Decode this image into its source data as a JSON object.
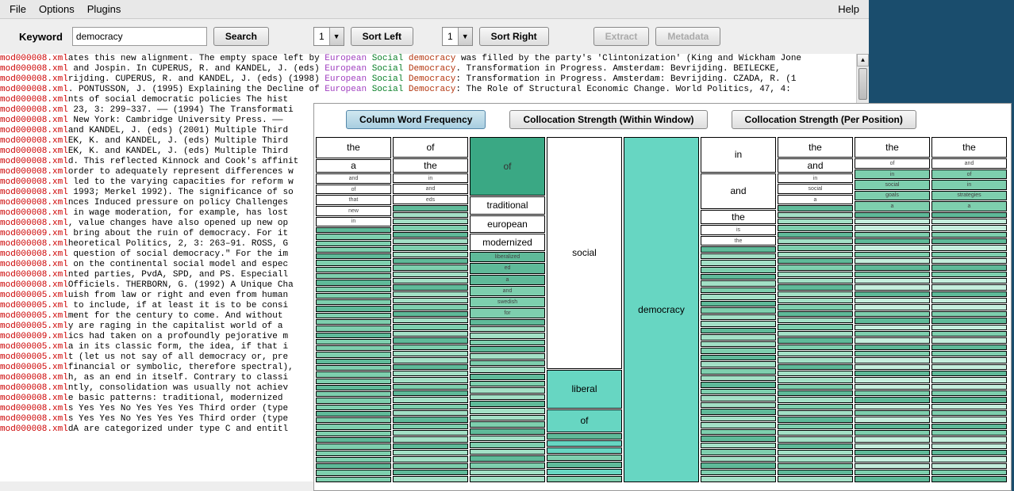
{
  "menubar": {
    "file": "File",
    "options": "Options",
    "plugins": "Plugins",
    "help": "Help"
  },
  "toolbar": {
    "keyword_label": "Keyword",
    "keyword_value": "democracy",
    "search": "Search",
    "sort_left": "Sort Left",
    "sort_right": "Sort Right",
    "extract": "Extract",
    "metadata": "Metadata",
    "sel_left": "1",
    "sel_right": "1"
  },
  "overlay": {
    "tab1": "Column Word Frequency",
    "tab2": "Collocation Strength (Within Window)",
    "tab3": "Collocation Strength (Per Position)"
  },
  "mosaic": {
    "col0": [
      "the",
      "a",
      "and",
      "of",
      "that",
      "new",
      "in"
    ],
    "col1": [
      "of",
      "the",
      "in",
      "and",
      "eds"
    ],
    "col2": [
      "of",
      "traditional",
      "european",
      "modernized",
      "liberalized",
      "ed",
      "a",
      "and",
      "swedish",
      "for"
    ],
    "col3": [
      "social",
      "liberal",
      "of"
    ],
    "col4": [
      "democracy"
    ],
    "col5": [
      "in",
      "and",
      "the",
      "is",
      "the"
    ],
    "col6": [
      "the",
      "and",
      "in",
      "social",
      "a"
    ],
    "col7": [
      "the",
      "of",
      "in",
      "social",
      "goals",
      "a"
    ],
    "col8": [
      "the",
      "and",
      "of",
      "in",
      "strategies",
      "a"
    ]
  },
  "concordance": [
    {
      "f": "mod000008.xml",
      "l": "ates this new alignment. The empty space left by ",
      "a": "European",
      "b": "Social",
      "c": "democracy",
      "r": " was filled by the party's 'Clintonization' (King and Wickham Jone"
    },
    {
      "f": "mod000008.xml",
      "l": " and Jospin. In CUPERUS, R. and KANDEL, J. (eds) ",
      "a": "European",
      "b": "Social",
      "c": "Democracy",
      "r": ". Transformation in Progress. Amsterdam: Bevrijding. BEILECKE,"
    },
    {
      "f": "mod000008.xml",
      "l": "rijding. CUPERUS, R. and KANDEL, J. (eds) (1998) ",
      "a": "European",
      "b": "Social",
      "c": "Democracy",
      "r": ": Transformation in Progress. Amsterdam: Bevrijding. CZADA, R. (1"
    },
    {
      "f": "mod000008.xml",
      "l": ". PONTUSSON, J. (1995) Explaining the Decline of ",
      "a": "European",
      "b": "Social",
      "c": "Democracy",
      "r": ": The Role of Structural Economic Change. World Politics, 47, 4:"
    },
    {
      "f": "mod000008.xml",
      "l": "nts of social democratic policies The hist",
      "a": "",
      "b": "",
      "c": "",
      "r": ""
    },
    {
      "f": "mod000008.xml",
      "l": " 23, 3: 299–337. —— (1994) The Transformati",
      "a": "",
      "b": "",
      "c": "",
      "r": ""
    },
    {
      "f": "mod000008.xml",
      "l": " New York: Cambridge University Press. ——",
      "a": "",
      "b": "",
      "c": "",
      "r": ""
    },
    {
      "f": "mod000008.xml",
      "l": "and KANDEL, J. (eds) (2001) Multiple Third",
      "a": "",
      "b": "",
      "c": "",
      "r": ""
    },
    {
      "f": "mod000008.xml",
      "l": "EK, K. and KANDEL, J. (eds) Multiple Third",
      "a": "",
      "b": "",
      "c": "",
      "r": ""
    },
    {
      "f": "mod000008.xml",
      "l": "EK, K. and KANDEL, J. (eds) Multiple Third",
      "a": "",
      "b": "",
      "c": "",
      "r": ""
    },
    {
      "f": "mod000008.xml",
      "l": "d. This reflected Kinnock and Cook's affinit",
      "a": "",
      "b": "",
      "c": "",
      "r": ""
    },
    {
      "f": "mod000008.xml",
      "l": "order to adequately represent differences w",
      "a": "",
      "b": "",
      "c": "",
      "r": ""
    },
    {
      "f": "mod000008.xml",
      "l": " led to the varying capacities for reform w",
      "a": "",
      "b": "",
      "c": "",
      "r": ""
    },
    {
      "f": "mod000008.xml",
      "l": " 1993; Merkel 1992). The significance of so",
      "a": "",
      "b": "",
      "c": "",
      "r": ""
    },
    {
      "f": "mod000008.xml",
      "l": "nces Induced pressure on policy Challenges",
      "a": "",
      "b": "",
      "c": "",
      "r": ""
    },
    {
      "f": "mod000008.xml",
      "l": " in wage moderation, for example, has lost",
      "a": "",
      "b": "",
      "c": "",
      "r": ""
    },
    {
      "f": "mod000008.xml",
      "l": ", value changes have also opened up new op",
      "a": "",
      "b": "",
      "c": "",
      "r": ""
    },
    {
      "f": "mod000009.xml",
      "l": " bring about the ruin of democracy. For it",
      "a": "",
      "b": "",
      "c": "",
      "r": ""
    },
    {
      "f": "mod000008.xml",
      "l": "heoretical Politics, 2, 3: 263–91. ROSS, G",
      "a": "",
      "b": "",
      "c": "",
      "r": ""
    },
    {
      "f": "mod000008.xml",
      "l": " question of social democracy.\" For the im",
      "a": "",
      "b": "",
      "c": "",
      "r": ""
    },
    {
      "f": "mod000008.xml",
      "l": " on the continental social model and espec",
      "a": "",
      "b": "",
      "c": "",
      "r": ""
    },
    {
      "f": "mod000008.xml",
      "l": "nted parties, PvdA, SPD, and PS. Especiall",
      "a": "",
      "b": "",
      "c": "",
      "r": ""
    },
    {
      "f": "mod000008.xml",
      "l": "Officiels. THERBORN, G. (1992) A Unique Cha",
      "a": "",
      "b": "",
      "c": "",
      "r": ""
    },
    {
      "f": "mod000005.xml",
      "l": "uish from law or right and even from human",
      "a": "",
      "b": "",
      "c": "",
      "r": ""
    },
    {
      "f": "mod000005.xml",
      "l": " to include, if at least it is to be consi",
      "a": "",
      "b": "",
      "c": "",
      "r": ""
    },
    {
      "f": "mod000005.xml",
      "l": "ment for the century to come. And without",
      "a": "",
      "b": "",
      "c": "",
      "r": ""
    },
    {
      "f": "mod000005.xml",
      "l": "y are raging in the capitalist world of a",
      "a": "",
      "b": "",
      "c": "",
      "r": ""
    },
    {
      "f": "mod000009.xml",
      "l": "ics had taken on a profoundly pejorative m",
      "a": "",
      "b": "",
      "c": "",
      "r": ""
    },
    {
      "f": "mod000005.xml",
      "l": "a in its classic form, the idea, if that i",
      "a": "",
      "b": "",
      "c": "",
      "r": ""
    },
    {
      "f": "mod000005.xml",
      "l": "t (let us not say of all democracy or, pre",
      "a": "",
      "b": "",
      "c": "",
      "r": ""
    },
    {
      "f": "mod000005.xml",
      "l": "financial or symbolic, therefore spectral),",
      "a": "",
      "b": "",
      "c": "",
      "r": ""
    },
    {
      "f": "mod000008.xml",
      "l": "h, as an end in itself. Contrary to classi",
      "a": "",
      "b": "",
      "c": "",
      "r": ""
    },
    {
      "f": "mod000008.xml",
      "l": "ntly, consolidation was usually not achiev",
      "a": "",
      "b": "",
      "c": "",
      "r": ""
    },
    {
      "f": "mod000008.xml",
      "l": "e basic patterns: traditional, modernized",
      "a": "",
      "b": "",
      "c": "",
      "r": ""
    },
    {
      "f": "mod000008.xml",
      "l": "s Yes Yes No Yes Yes Yes Third order (type",
      "a": "",
      "b": "",
      "c": "",
      "r": ""
    },
    {
      "f": "mod000008.xml",
      "l": "s Yes Yes No Yes Yes Yes Third order (type",
      "a": "",
      "b": "",
      "c": "",
      "r": ""
    },
    {
      "f": "mod000008.xml",
      "l": "dA are categorized under type C and entitl",
      "a": "",
      "b": "",
      "c": "",
      "r": ""
    }
  ]
}
